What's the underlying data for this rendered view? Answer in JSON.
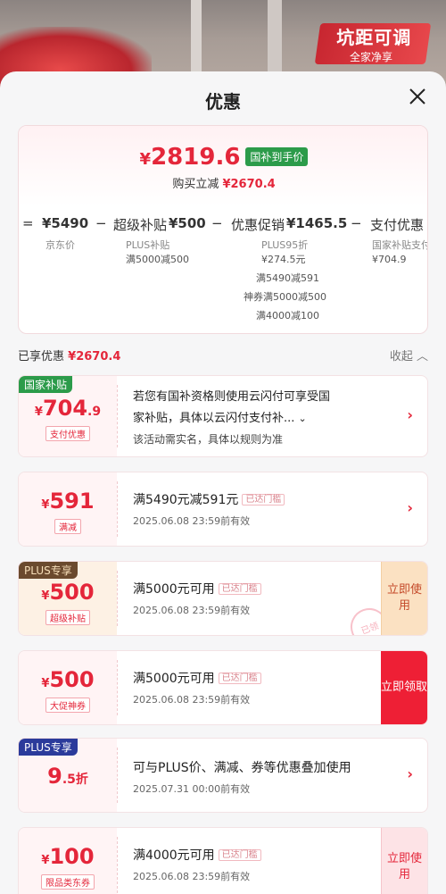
{
  "background": {
    "promo_line1": "坑距可调",
    "promo_line2": "全家净享"
  },
  "sheet": {
    "title": "优惠",
    "close_icon": "close-icon"
  },
  "summary": {
    "price_yen": "¥",
    "price": "2819.6",
    "price_tag": "国补到手价",
    "reduce_label": "购买立减",
    "reduce_amount": "¥2670.4",
    "breakdown": {
      "eq": "=",
      "jd_price": "¥5490",
      "jd_price_label": "京东价",
      "minus1": "−",
      "plus_label": "超级补贴",
      "plus_amount": "¥500",
      "plus_sub1": "PLUS补贴",
      "plus_sub2": "满5000减500",
      "minus2": "−",
      "promo_label": "优惠促销",
      "promo_amount": "¥1465.5",
      "promo_sub1": "PLUS95折",
      "promo_sub2": "¥274.5元",
      "promo_sub3": "满5490减591",
      "promo_sub4": "神券满5000减500",
      "promo_sub5": "满4000减100",
      "minus3": "−",
      "pay_label": "支付优惠",
      "pay_sub1": "国家补贴支付",
      "pay_sub2": "¥704.9"
    }
  },
  "enjoyed": {
    "label": "已享优惠",
    "amount": "¥2670.4",
    "collapse": "收起"
  },
  "coupons": [
    {
      "corner": "国家补贴",
      "yen": "¥",
      "amount": "704",
      "decimal": ".9",
      "kind": "支付优惠",
      "desc1": "若您有国补资格则使用云闪付可享受国",
      "desc2": "家补贴，具体以云闪付支付补...",
      "desc3": "该活动需实名，具体以规则为准"
    },
    {
      "yen": "¥",
      "amount": "591",
      "kind": "满减",
      "desc": "满5490元减591元",
      "met": "已达门槛",
      "exp": "2025.06.08 23:59前有效"
    },
    {
      "corner": "PLUS专享",
      "yen": "¥",
      "amount": "500",
      "kind": "超级补贴",
      "desc": "满5000元可用",
      "met": "已达门槛",
      "exp": "2025.06.08 23:59前有效",
      "action": "立即使用",
      "stamp": "已领"
    },
    {
      "yen": "¥",
      "amount": "500",
      "kind": "大促神券",
      "desc": "满5000元可用",
      "met": "已达门槛",
      "exp": "2025.06.08 23:59前有效",
      "action": "立即领取"
    },
    {
      "corner": "PLUS专享",
      "amount": "9",
      "decimal": ".5",
      "unit": "折",
      "desc": "可与PLUS价、满减、券等优惠叠加使用",
      "exp": "2025.07.31 00:00前有效"
    },
    {
      "yen": "¥",
      "amount": "100",
      "kind": "限品类东券",
      "desc": "满4000元可用",
      "met": "已达门槛",
      "exp": "2025.06.08 23:59前有效",
      "action": "立即使用"
    }
  ],
  "colors": {
    "accent": "#e4263a",
    "gov_green": "#2c9b4a",
    "plus_brown": "#6b4a2e",
    "plus_blue": "#2b3b9b"
  }
}
